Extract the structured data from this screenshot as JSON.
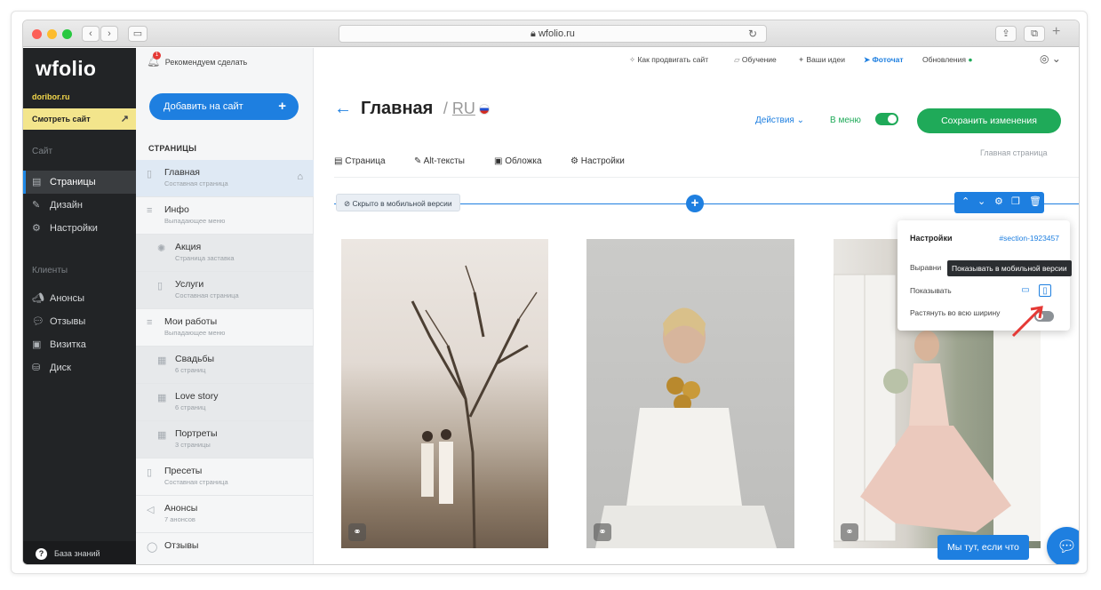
{
  "browser": {
    "url": "wfolio.ru"
  },
  "sidebar": {
    "logo": "wfolio",
    "domain": "doribor.ru",
    "view_site": "Смотреть сайт",
    "section_site": "Сайт",
    "site_items": [
      {
        "label": "Страницы",
        "active": true
      },
      {
        "label": "Дизайн"
      },
      {
        "label": "Настройки"
      }
    ],
    "section_clients": "Клиенты",
    "client_items": [
      {
        "label": "Анонсы"
      },
      {
        "label": "Отзывы"
      },
      {
        "label": "Визитка"
      },
      {
        "label": "Диск"
      }
    ],
    "knowledge_base": "База знаний"
  },
  "pages_panel": {
    "recommend": "Рекомендуем сделать",
    "recommend_count": "1",
    "add_button": "Добавить на сайт",
    "title": "СТРАНИЦЫ",
    "items": [
      {
        "title": "Главная",
        "subtitle": "Составная страница"
      },
      {
        "title": "Инфо",
        "subtitle": "Выпадающее меню"
      },
      {
        "title": "Акция",
        "subtitle": "Страница заставка"
      },
      {
        "title": "Услуги",
        "subtitle": "Составная страница"
      },
      {
        "title": "Мои работы",
        "subtitle": "Выпадающее меню"
      },
      {
        "title": "Свадьбы",
        "subtitle": "6 страниц"
      },
      {
        "title": "Love story",
        "subtitle": "6 страниц"
      },
      {
        "title": "Портреты",
        "subtitle": "3 страницы"
      },
      {
        "title": "Пресеты",
        "subtitle": "Составная страница"
      },
      {
        "title": "Анонсы",
        "subtitle": "7 анонсов"
      },
      {
        "title": "Отзывы",
        "subtitle": ""
      }
    ]
  },
  "topnav": {
    "promote": "Как продвигать сайт",
    "learning": "Обучение",
    "ideas": "Ваши идеи",
    "photochat": "Фоточат",
    "updates": "Обновления"
  },
  "header": {
    "title": "Главная",
    "lang": "RU",
    "actions": "Действия",
    "in_menu": "В меню",
    "save": "Сохранить изменения",
    "page_type": "Главная страница"
  },
  "tabs": [
    "Страница",
    "Alt-тексты",
    "Обложка",
    "Настройки"
  ],
  "editor": {
    "hidden_mobile": "Скрыто в мобильной версии"
  },
  "popup": {
    "title": "Настройки",
    "section_id": "#section-1923457",
    "align_label": "Выравни",
    "tooltip": "Показывать в мобильной версии",
    "show_label": "Показывать",
    "stretch_label": "Растянуть во всю ширину"
  },
  "help": {
    "label": "Мы тут, если что"
  }
}
